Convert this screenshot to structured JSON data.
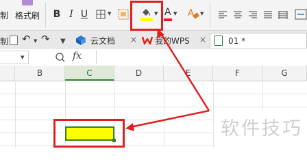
{
  "ribbon": {
    "cut_label": "制",
    "format_painter_label": "格式刷",
    "bold_label": "B",
    "italic_label": "I",
    "underline_label": "U",
    "font_color_label": "A",
    "fill_color": "#ffff00",
    "font_color": "#e02020",
    "accent_color": "#217346"
  },
  "tabs": {
    "items": [
      {
        "label": "云文档"
      },
      {
        "label": "我的WPS"
      },
      {
        "label": "01 *"
      }
    ]
  },
  "formula_bar": {
    "fx_label": "fx"
  },
  "sheet": {
    "columns": [
      "B",
      "C",
      "D",
      "E",
      "F",
      "G"
    ],
    "selected_column": "C",
    "selected_cell_fill": "#ffff00"
  },
  "watermark": {
    "text": "软件技巧"
  },
  "annotation": {
    "highlight_color": "#e02020"
  }
}
